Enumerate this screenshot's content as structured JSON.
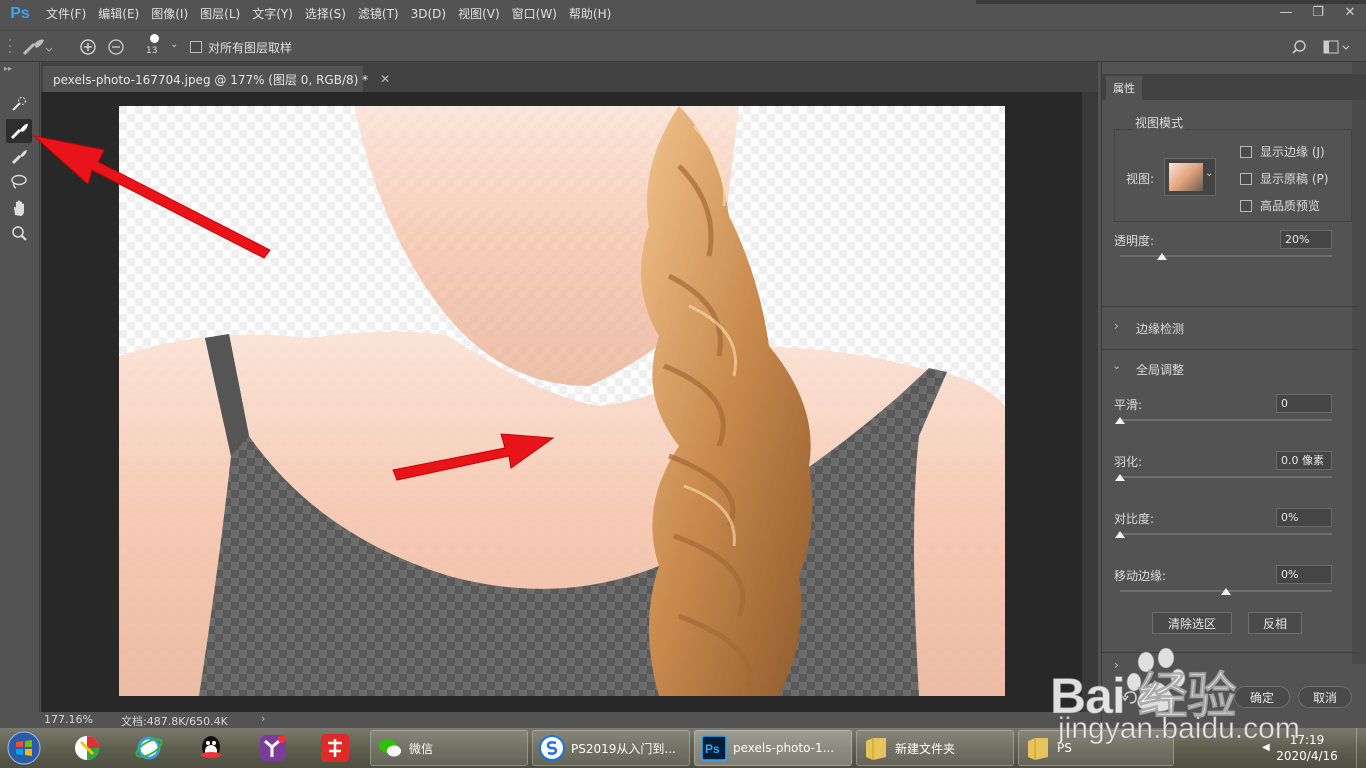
{
  "app": {
    "logo": "Ps"
  },
  "menu": [
    "文件(F)",
    "编辑(E)",
    "图像(I)",
    "图层(L)",
    "文字(Y)",
    "选择(S)",
    "滤镜(T)",
    "3D(D)",
    "视图(V)",
    "窗口(W)",
    "帮助(H)"
  ],
  "options": {
    "brush_size": "13",
    "sample_all_layers_label": "对所有图层取样"
  },
  "document": {
    "tab_title": "pexels-photo-167704.jpeg @ 177% (图层 0, RGB/8) *"
  },
  "status": {
    "zoom": "177.16%",
    "doc_info": "文档:487.8K/650.4K"
  },
  "properties": {
    "tab": "属性",
    "view_mode": {
      "title": "视图模式",
      "view_label": "视图:",
      "show_edge": "显示边缘 (J)",
      "show_original": "显示原稿 (P)",
      "hq_preview": "高品质预览"
    },
    "opacity": {
      "label": "透明度:",
      "value": "20%",
      "level": 0.2
    },
    "edge_detection": {
      "title": "边缘检测"
    },
    "global_refine": {
      "title": "全局调整",
      "smooth": {
        "label": "平滑:",
        "value": "0",
        "level": 0
      },
      "feather": {
        "label": "羽化:",
        "value": "0.0 像素",
        "level": 0
      },
      "contrast": {
        "label": "对比度:",
        "value": "0%",
        "level": 0
      },
      "shift_edge": {
        "label": "移动边缘:",
        "value": "0%",
        "level": 0.5
      }
    },
    "clear_selection": "清除选区",
    "invert": "反相",
    "ok": "确定",
    "cancel": "取消"
  },
  "taskbar": {
    "items": [
      {
        "label": "微信"
      },
      {
        "label": "PS2019从入门到..."
      },
      {
        "label": "pexels-photo-1..."
      },
      {
        "label": "新建文件夹"
      },
      {
        "label": "PS"
      }
    ],
    "time": "17:19",
    "date": "2020/4/16"
  },
  "watermark": {
    "brand": "Bai 经验",
    "url": "jingyan.baidu.com"
  },
  "colors": {
    "ps_blue": "#31a8ff",
    "arrow_red": "#e8141a",
    "panel_bg": "#535353",
    "canvas_bg": "#282828"
  }
}
